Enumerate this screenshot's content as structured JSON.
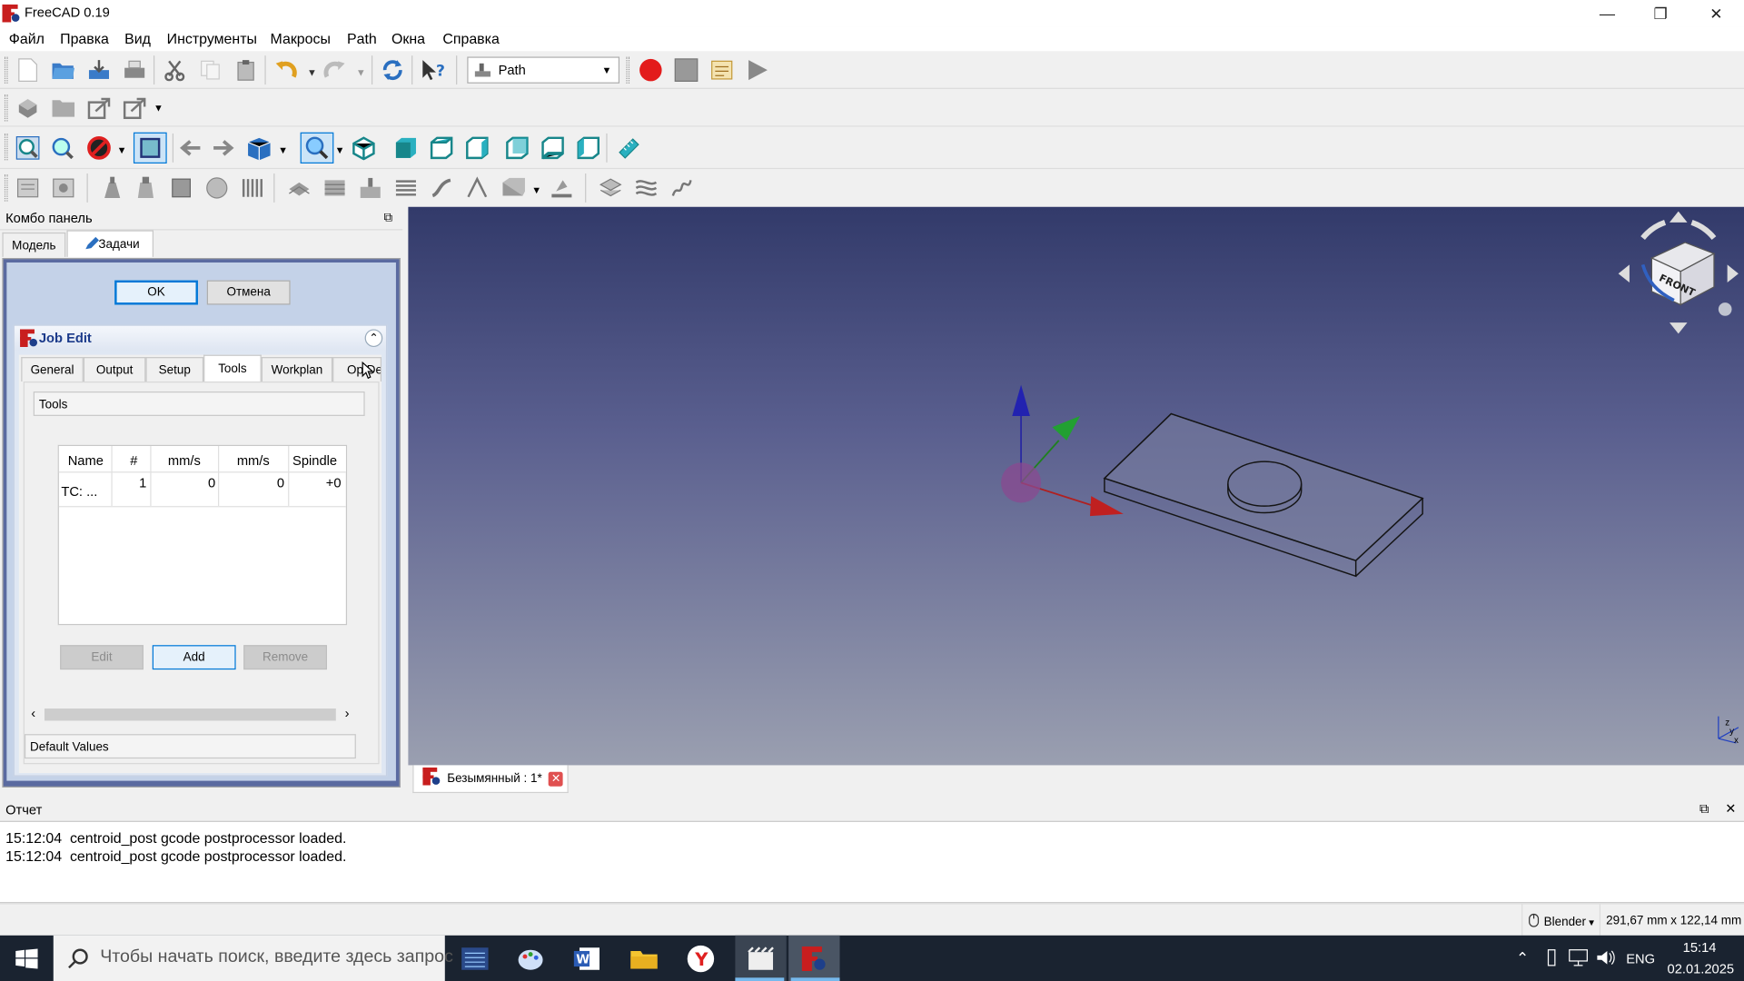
{
  "app": {
    "title": "FreeCAD 0.19"
  },
  "window_controls": {
    "minimize": "—",
    "maximize": "❐",
    "close": "✕"
  },
  "menu": [
    "Файл",
    "Правка",
    "Вид",
    "Инструменты",
    "Макросы",
    "Path",
    "Окна",
    "Справка"
  ],
  "toolbar": {
    "workbench_selected": "Path"
  },
  "combo": {
    "title": "Комбо панель",
    "tabs": [
      {
        "label": "Модель"
      },
      {
        "label": "Задачи",
        "active": true
      }
    ],
    "ok_label": "OK",
    "cancel_label": "Отмена"
  },
  "job_edit": {
    "title": "Job Edit",
    "tabs": [
      "General",
      "Output",
      "Setup",
      "Tools",
      "Workplan",
      "Op Def"
    ],
    "active_tab": "Tools",
    "section_tools": "Tools",
    "table": {
      "columns": [
        "Name",
        "#",
        "mm/s",
        "mm/s",
        "Spindle"
      ],
      "rows": [
        [
          "TC: ...",
          "1",
          "0",
          "0",
          "+0"
        ]
      ]
    },
    "buttons": {
      "edit": "Edit",
      "add": "Add",
      "remove": "Remove"
    },
    "section_defaults": "Default Values"
  },
  "doc_tab": {
    "label": "Безымянный : 1*"
  },
  "report": {
    "title": "Отчет",
    "lines": [
      {
        "time": "15:12:04",
        "text": "centroid_post gcode postprocessor loaded."
      },
      {
        "time": "15:12:04",
        "text": "centroid_post gcode postprocessor loaded."
      }
    ]
  },
  "status": {
    "nav_style": "Blender",
    "dimensions": "291,67 mm x 122,14 mm"
  },
  "taskbar": {
    "search_placeholder": "Чтобы начать поиск, введите здесь запрос",
    "language": "ENG",
    "time": "15:14",
    "date": "02.01.2025"
  },
  "colors": {
    "viewport_top": "#323a6a",
    "viewport_bottom": "#9a9fb0",
    "accent": "#0078d7",
    "record": "#e31b1b"
  }
}
